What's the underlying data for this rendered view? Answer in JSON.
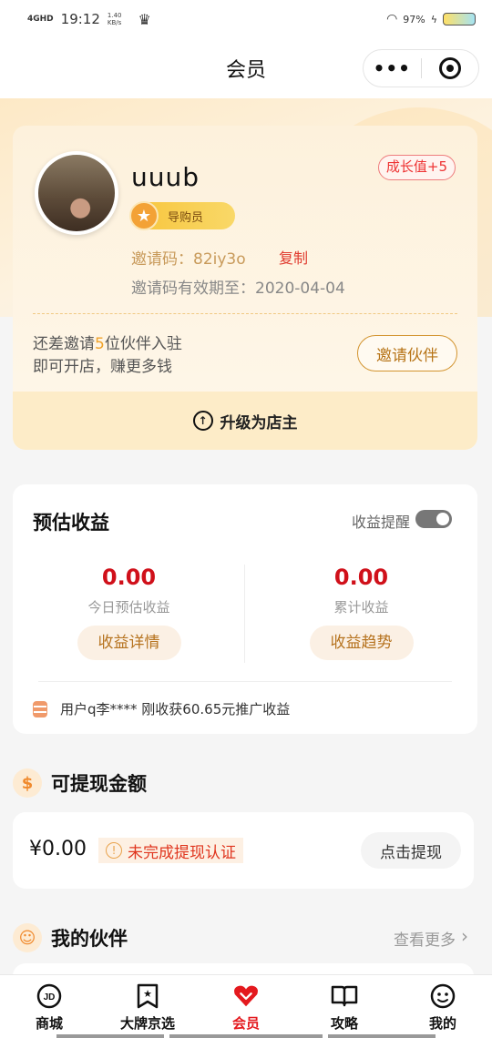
{
  "status_bar": {
    "network": "4GHD",
    "time": "19:12",
    "speed_value": "1.40",
    "speed_unit": "KB/s",
    "battery_percent": "97%"
  },
  "nav": {
    "title": "会员",
    "more_label": "•••"
  },
  "profile": {
    "username": "uuub",
    "growth_badge": "成长值+5",
    "role": "导购员",
    "invite_code": "邀请码：82iy3o",
    "copy_label": "复制",
    "expiry": "邀请码有效期至：2020-04-04",
    "invite_tip_pre": "还差邀请",
    "invite_tip_count": "5",
    "invite_tip_post": "位伙伴入驻",
    "invite_tip_line2": "即可开店，赚更多钱",
    "invite_button": "邀请伙伴",
    "upgrade_label": "升级为店主"
  },
  "earnings": {
    "title": "预估收益",
    "remind_label": "收益提醒",
    "remind_on": true,
    "today_value": "0.00",
    "today_label": "今日预估收益",
    "today_button": "收益详情",
    "total_value": "0.00",
    "total_label": "累计收益",
    "total_button": "收益趋势",
    "ticker": "用户q李**** 刚收获60.65元推广收益"
  },
  "withdraw": {
    "title": "可提现金额",
    "amount": "¥0.00",
    "warning": "未完成提现认证",
    "button": "点击提现"
  },
  "partners": {
    "title": "我的伙伴",
    "more_label": "查看更多"
  },
  "tabs": [
    {
      "label": "商城",
      "icon": "jd-logo-icon"
    },
    {
      "label": "大牌京选",
      "icon": "bookmark-star-icon"
    },
    {
      "label": "会员",
      "icon": "heart-badge-icon",
      "active": true
    },
    {
      "label": "攻略",
      "icon": "book-icon"
    },
    {
      "label": "我的",
      "icon": "smiley-face-icon"
    }
  ],
  "colors": {
    "accent_red": "#e4191e",
    "gold": "#c89a5a",
    "card_cream": "#fdf1dc"
  }
}
